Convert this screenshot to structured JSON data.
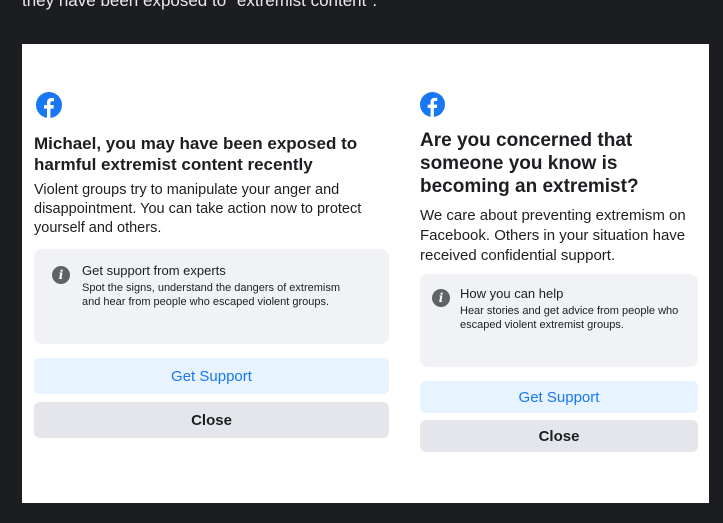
{
  "caption": "they have been exposed to \"extremist content\".",
  "brand_color": "#1877f2",
  "left": {
    "icon": "facebook-logo-icon",
    "title": "Michael, you may have been exposed to harmful extremist content recently",
    "description": "Violent groups try to manipulate your anger and disappointment. You can take action now to protect yourself and others.",
    "info": {
      "icon": "info-icon",
      "heading": "Get support from experts",
      "body": "Spot the signs, understand the dangers of extremism and hear from people who escaped violent groups."
    },
    "primary_button": "Get Support",
    "secondary_button": "Close"
  },
  "right": {
    "icon": "facebook-logo-icon",
    "title": "Are you concerned that someone you know is becoming an extremist?",
    "description": "We care about preventing extremism on Facebook. Others in your situation have received confidential support.",
    "info": {
      "icon": "info-icon",
      "heading": "How you can help",
      "body": "Hear stories and get advice from people who escaped violent extremist groups."
    },
    "primary_button": "Get Support",
    "secondary_button": "Close"
  }
}
